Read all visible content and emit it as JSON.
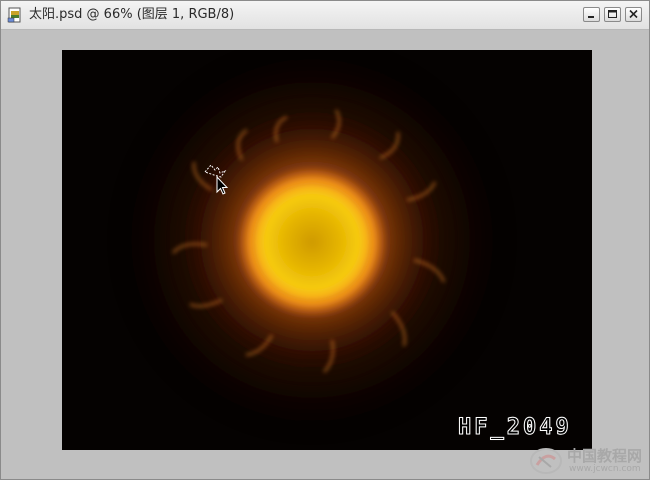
{
  "window": {
    "title": "太阳.psd @ 66% (图层 1, RGB/8)",
    "controls": {
      "minimize_icon": "minimize-icon",
      "maximize_icon": "maximize-icon",
      "close_icon": "close-icon"
    }
  },
  "canvas": {
    "background_color": "#050201",
    "sun_core_color": "#e7b800",
    "sun_glow_color": "#d06a10",
    "watermark_text": "HF_2049"
  },
  "site_logo": {
    "name": "中国教程网",
    "url": "www.jcwcn.com"
  },
  "colors": {
    "workspace_gray": "#c0c0c0",
    "titlebar_light": "#f4f4f4"
  }
}
